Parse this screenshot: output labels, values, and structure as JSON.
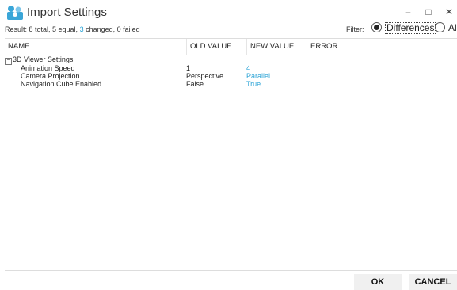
{
  "window": {
    "title": "Import Settings",
    "controls": {
      "minimize": "–",
      "maximize": "□",
      "close": "✕"
    }
  },
  "result": {
    "prefix": "Result: 8 total, 5 equal, ",
    "changed": "3",
    "suffix": " changed, 0 failed"
  },
  "filter": {
    "label": "Filter:",
    "options": [
      {
        "label": "Differences",
        "selected": true
      },
      {
        "label": "All",
        "selected": false
      }
    ]
  },
  "grid": {
    "columns": [
      "NAME",
      "OLD VALUE",
      "NEW VALUE",
      "ERROR"
    ],
    "group": {
      "toggle": "⊟",
      "label": "3D Viewer Settings"
    },
    "rows": [
      {
        "name": "Animation Speed",
        "old": "1",
        "new": "4",
        "error": ""
      },
      {
        "name": "Camera Projection",
        "old": "Perspective",
        "new": "Parallel",
        "error": ""
      },
      {
        "name": "Navigation Cube Enabled",
        "old": "False",
        "new": "True",
        "error": ""
      }
    ]
  },
  "buttons": {
    "ok": "OK",
    "cancel": "CANCEL"
  },
  "colors": {
    "accent": "#2aa3d6"
  }
}
